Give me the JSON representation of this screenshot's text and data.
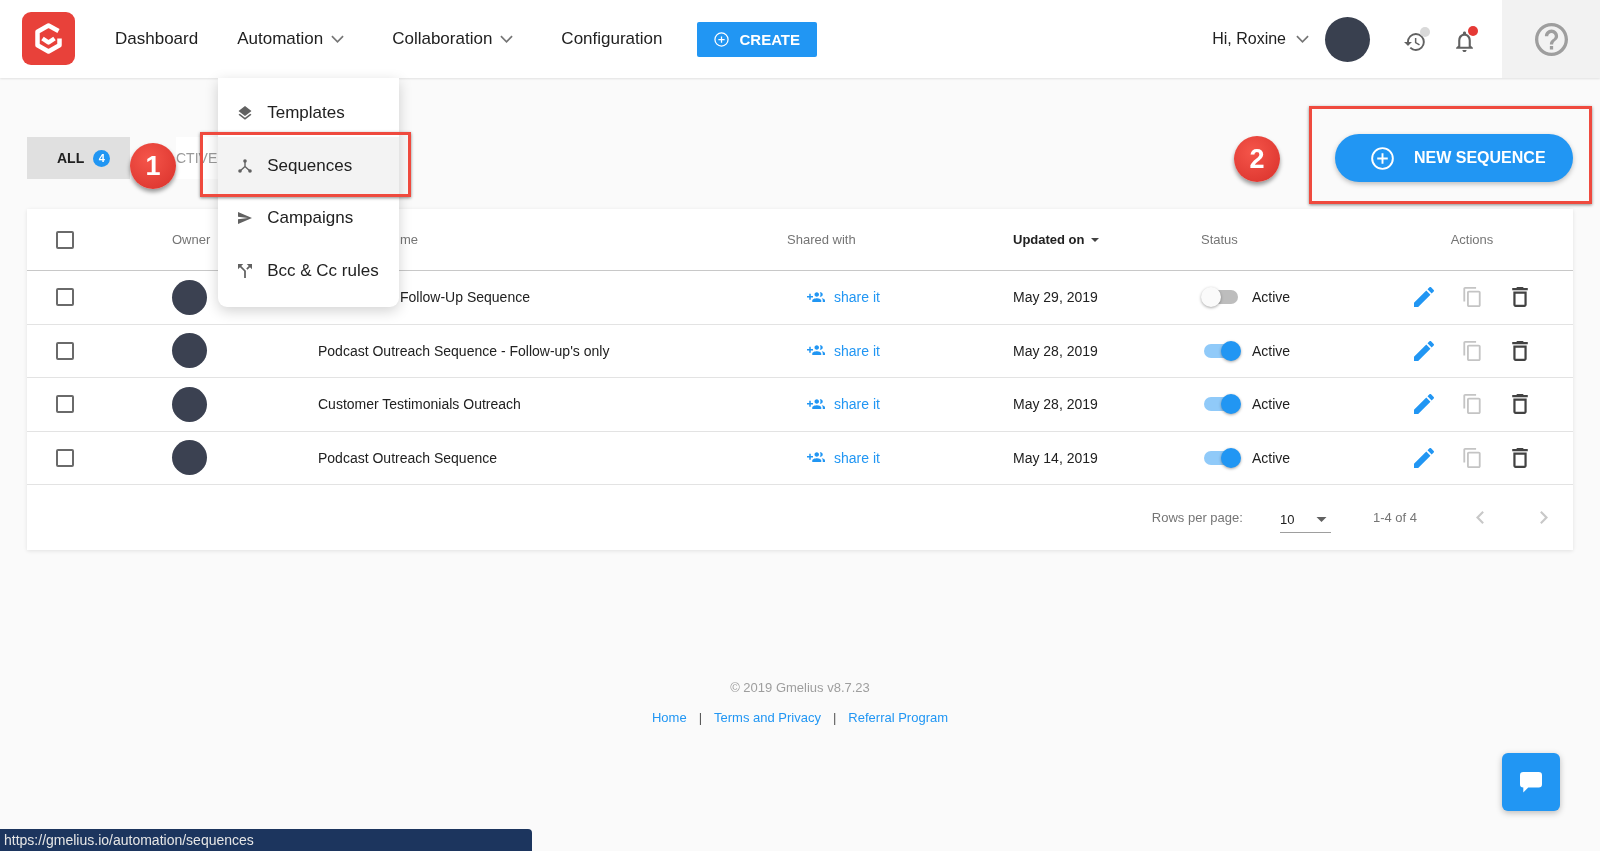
{
  "header": {
    "nav": [
      {
        "label": "Dashboard",
        "kind": "link"
      },
      {
        "label": "Automation",
        "kind": "menu",
        "expanded": true,
        "items": [
          {
            "label": "Templates",
            "selected": false
          },
          {
            "label": "Sequences",
            "selected": true
          },
          {
            "label": "Campaigns",
            "selected": false
          },
          {
            "label": "Bcc & Cc rules",
            "selected": false
          }
        ]
      },
      {
        "label": "Collaboration",
        "kind": "menu"
      },
      {
        "label": "Configuration",
        "kind": "link"
      }
    ],
    "create_button": "CREATE",
    "greeting": "Hi, Roxine",
    "icons": [
      {
        "kind": "history",
        "color": "#d9d9d9"
      },
      {
        "kind": "bell",
        "color": "#e53935"
      }
    ]
  },
  "tabs": [
    {
      "label": "ALL",
      "count": "4",
      "selected": true
    },
    {
      "label": "CTIVE",
      "selected": false
    }
  ],
  "new_sequence_button": "NEW SEQUENCE",
  "annotations": [
    {
      "number": "1"
    },
    {
      "number": "2"
    }
  ],
  "table": {
    "select_all": {
      "checked": false
    },
    "columns": [
      {
        "label": "Owner",
        "sorted": false
      },
      {
        "label": "me",
        "sorted": false
      },
      {
        "label": "Shared with",
        "sorted": false
      },
      {
        "label": "Updated on",
        "sorted": true
      },
      {
        "label": "Status",
        "sorted": false
      },
      {
        "label": "Actions",
        "sorted": false
      }
    ],
    "rows": [
      {
        "checked": false,
        "name": "Follow-Up Sequence",
        "share": "share it",
        "updated": "May 29, 2019",
        "active": false,
        "status": "Active"
      },
      {
        "checked": false,
        "name": "Podcast Outreach Sequence - Follow-up's only",
        "share": "share it",
        "updated": "May 28, 2019",
        "active": true,
        "status": "Active"
      },
      {
        "checked": false,
        "name": "Customer Testimonials Outreach",
        "share": "share it",
        "updated": "May 28, 2019",
        "active": true,
        "status": "Active"
      },
      {
        "checked": false,
        "name": "Podcast Outreach Sequence",
        "share": "share it",
        "updated": "May 14, 2019",
        "active": true,
        "status": "Active"
      }
    ],
    "pagination": {
      "rows_per_page_label": "Rows per page:",
      "rows_per_page": "10",
      "range": "1-4 of 4",
      "prev_disabled": true,
      "next_disabled": true
    }
  },
  "footer": {
    "copyright": "© 2019 Gmelius v8.7.23",
    "links": [
      {
        "label": "Home"
      },
      {
        "separator": "|",
        "label": "Terms and Privacy"
      },
      {
        "separator": "|",
        "label": "Referral Program"
      }
    ]
  },
  "status_bar": {
    "url": "https://gmelius.io/automation/sequences"
  }
}
